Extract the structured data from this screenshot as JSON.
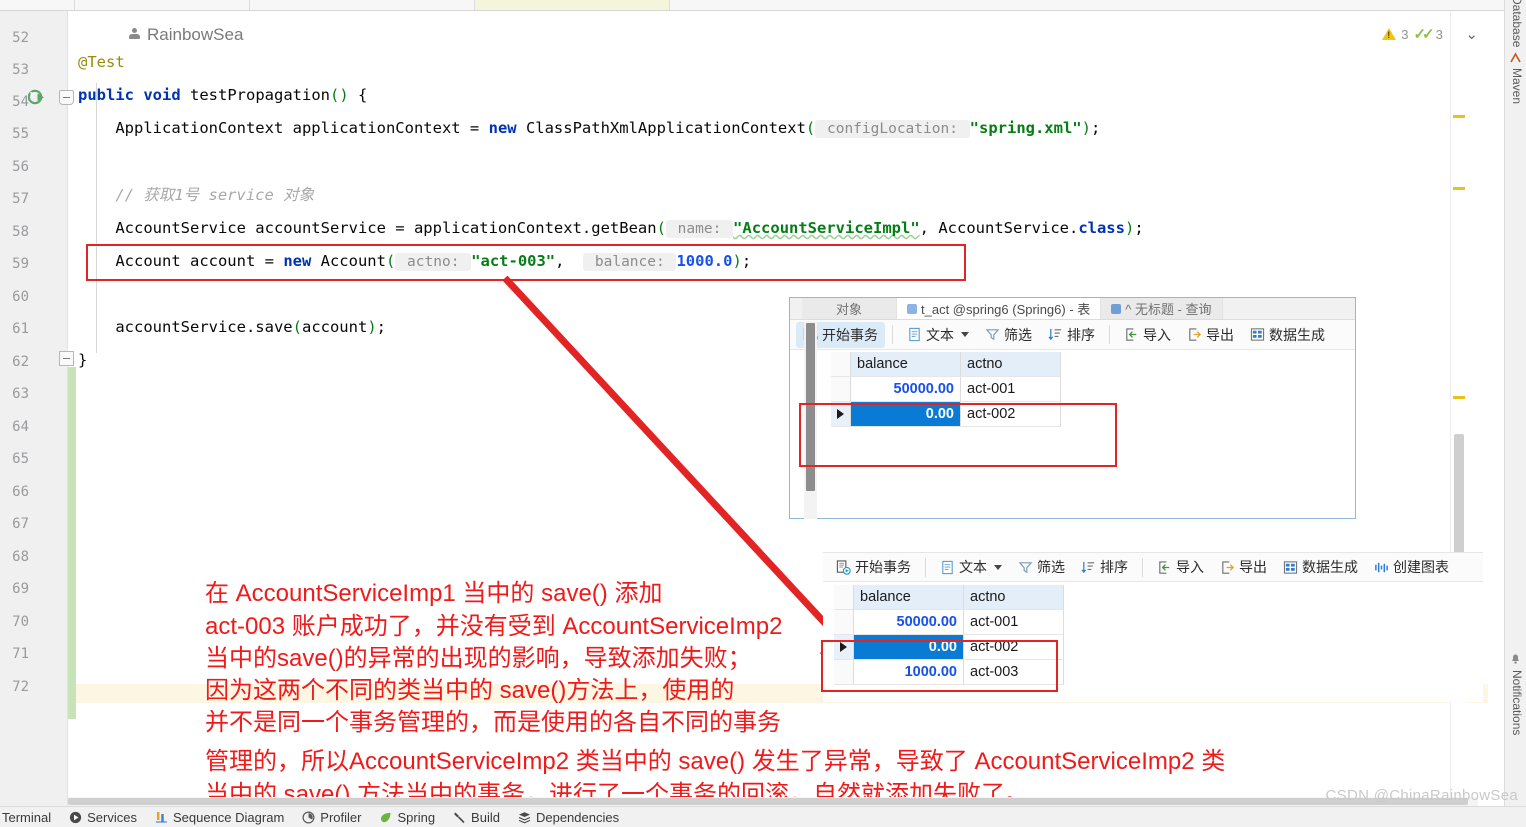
{
  "window": {
    "watermark": "CSDN @ChinaRainbowSea"
  },
  "tabstrip": {
    "tabs": [
      {
        "label": "",
        "state": "plain"
      },
      {
        "label": "",
        "state": "plain"
      },
      {
        "label": "",
        "state": "active"
      },
      {
        "label": "",
        "state": "plain"
      }
    ]
  },
  "editor": {
    "breadcrumb": "RainbowSea",
    "breadcrumb_icon": "person-icon",
    "inspections": {
      "warning_icon": "warning-triangle-icon",
      "warning_count": "3",
      "check_icon": "double-check-icon",
      "check_count": "3",
      "up_icon": "chevron-up-icon",
      "down_icon": "chevron-down-icon"
    },
    "line_numbers": [
      "52",
      "53",
      "54",
      "55",
      "56",
      "57",
      "58",
      "59",
      "60",
      "61",
      "62",
      "63",
      "64",
      "65",
      "66",
      "67",
      "68",
      "69",
      "70",
      "71",
      "72"
    ],
    "lines": [
      {
        "n": 0,
        "tokens": [
          {
            "t": "@Test",
            "c": "anno"
          }
        ]
      },
      {
        "n": 1,
        "tokens": [
          {
            "t": "public",
            "c": "kw"
          },
          {
            "t": " ",
            "c": "plain"
          },
          {
            "t": "void",
            "c": "kw"
          },
          {
            "t": " testPropagation",
            "c": "plain"
          },
          {
            "t": "()",
            "c": "paren"
          },
          {
            "t": " {",
            "c": "plain"
          }
        ]
      },
      {
        "n": 2,
        "tokens": [
          {
            "t": "    ApplicationContext applicationContext = ",
            "c": "plain"
          },
          {
            "t": "new",
            "c": "kw"
          },
          {
            "t": " ClassPathXmlApplicationContext",
            "c": "plain"
          },
          {
            "t": "(",
            "c": "paren"
          },
          {
            "t": " configLocation: ",
            "c": "hint"
          },
          {
            "t": "\"spring.xml\"",
            "c": "str"
          },
          {
            "t": ")",
            "c": "paren"
          },
          {
            "t": ";",
            "c": "plain"
          }
        ]
      },
      {
        "n": 3,
        "tokens": []
      },
      {
        "n": 4,
        "tokens": [
          {
            "t": "    // 获取1号 service 对象",
            "c": "cmt"
          }
        ]
      },
      {
        "n": 5,
        "tokens": [
          {
            "t": "    AccountService accountService = applicationContext.getBean",
            "c": "plain"
          },
          {
            "t": "(",
            "c": "paren"
          },
          {
            "t": " name: ",
            "c": "hint"
          },
          {
            "t": "\"AccountServiceImpl\"",
            "c": "str"
          },
          {
            "t": ", AccountService.",
            "c": "plain"
          },
          {
            "t": "class",
            "c": "kw"
          },
          {
            "t": ")",
            "c": "paren"
          },
          {
            "t": ";",
            "c": "plain"
          }
        ]
      },
      {
        "n": 6,
        "tokens": [
          {
            "t": "    Account account = ",
            "c": "plain"
          },
          {
            "t": "new",
            "c": "kw"
          },
          {
            "t": " Account",
            "c": "plain"
          },
          {
            "t": "(",
            "c": "paren"
          },
          {
            "t": " actno: ",
            "c": "hint"
          },
          {
            "t": "\"act-003\"",
            "c": "str"
          },
          {
            "t": ",  ",
            "c": "plain"
          },
          {
            "t": " balance: ",
            "c": "hint"
          },
          {
            "t": "1000.0",
            "c": "num"
          },
          {
            "t": ")",
            "c": "paren"
          },
          {
            "t": ";",
            "c": "plain"
          }
        ]
      },
      {
        "n": 7,
        "tokens": []
      },
      {
        "n": 8,
        "tokens": [
          {
            "t": "    accountService.save",
            "c": "plain"
          },
          {
            "t": "(",
            "c": "paren"
          },
          {
            "t": "account",
            "c": "plain"
          },
          {
            "t": ")",
            "c": "paren"
          },
          {
            "t": ";",
            "c": "plain"
          }
        ]
      },
      {
        "n": 9,
        "tokens": []
      },
      {
        "n": 10,
        "tokens": [
          {
            "t": "}",
            "c": "plain"
          }
        ]
      }
    ]
  },
  "db_window_top": {
    "tabs": [
      {
        "label": "对象",
        "icon": "object-tab-icon",
        "state": "dim"
      },
      {
        "label": "t_act @spring6 (Spring6) - 表",
        "icon": "table-tab-icon",
        "state": "sel"
      },
      {
        "label": "^ 无标题 - 查询",
        "icon": "query-tab-icon",
        "state": "dim"
      }
    ],
    "toolbar": [
      {
        "label": "开始事务",
        "icon": "begin-transaction-icon",
        "active": true
      },
      {
        "sep": true
      },
      {
        "label": "文本",
        "icon": "text-icon",
        "caret": true
      },
      {
        "label": "筛选",
        "icon": "filter-icon"
      },
      {
        "label": "排序",
        "icon": "sort-icon"
      },
      {
        "sep": true
      },
      {
        "label": "导入",
        "icon": "import-icon"
      },
      {
        "label": "导出",
        "icon": "export-icon"
      },
      {
        "label": "数据生成",
        "icon": "data-generate-icon"
      }
    ],
    "grid": {
      "columns": [
        "balance",
        "actno"
      ],
      "rows": [
        {
          "cells": [
            "50000.00",
            "act-001"
          ],
          "selected": false,
          "current": false
        },
        {
          "cells": [
            "0.00",
            "act-002"
          ],
          "selected": true,
          "current": true
        }
      ]
    }
  },
  "db_window_bottom": {
    "toolbar": [
      {
        "label": "开始事务",
        "icon": "begin-transaction-icon",
        "active": false
      },
      {
        "sep": true
      },
      {
        "label": "文本",
        "icon": "text-icon",
        "caret": true
      },
      {
        "label": "筛选",
        "icon": "filter-icon"
      },
      {
        "label": "排序",
        "icon": "sort-icon"
      },
      {
        "sep": true
      },
      {
        "label": "导入",
        "icon": "import-icon"
      },
      {
        "label": "导出",
        "icon": "export-icon"
      },
      {
        "label": "数据生成",
        "icon": "data-generate-icon"
      },
      {
        "label": "创建图表",
        "icon": "create-chart-icon"
      }
    ],
    "grid": {
      "columns": [
        "balance",
        "actno"
      ],
      "rows": [
        {
          "cells": [
            "50000.00",
            "act-001"
          ],
          "selected": false,
          "current": false
        },
        {
          "cells": [
            "0.00",
            "act-002"
          ],
          "selected": true,
          "current": true
        },
        {
          "cells": [
            "1000.00",
            "act-003"
          ],
          "selected": false,
          "current": false
        }
      ]
    }
  },
  "annotation": {
    "color": "#f01a1a",
    "lines": [
      "在 AccountServiceImp1 当中的 save() 添加",
      "act-003 账户成功了，并没有受到 AccountServiceImp2",
      "当中的save()的异常的出现的影响，导致添加失败；",
      "因为这两个不同的类当中的 save()方法上，使用的",
      "并不是同一个事务管理的，而是使用的各自不同的事务"
    ],
    "lines_wide": [
      "管理的，所以AccountServiceImp2 类当中的 save() 发生了异常，导致了 AccountServiceImp2 类",
      "当中的 save() 方法当中的事务，进行了一个事务的回滚，自然就添加失败了。"
    ]
  },
  "right_strip": {
    "labels": [
      {
        "text": "Database",
        "icon": "database-icon"
      },
      {
        "text": "Maven",
        "icon": "maven-icon"
      },
      {
        "text": "Notifications",
        "icon": "notifications-icon"
      }
    ]
  },
  "statusbar": {
    "items": [
      {
        "label": "Terminal",
        "icon": "terminal-icon"
      },
      {
        "label": "Services",
        "icon": "services-icon"
      },
      {
        "label": "Sequence Diagram",
        "icon": "sequence-diagram-icon"
      },
      {
        "label": "Profiler",
        "icon": "profiler-icon"
      },
      {
        "label": "Spring",
        "icon": "spring-leaf-icon"
      },
      {
        "label": "Build",
        "icon": "build-hammer-icon"
      },
      {
        "label": "Dependencies",
        "icon": "dependencies-icon"
      }
    ]
  }
}
